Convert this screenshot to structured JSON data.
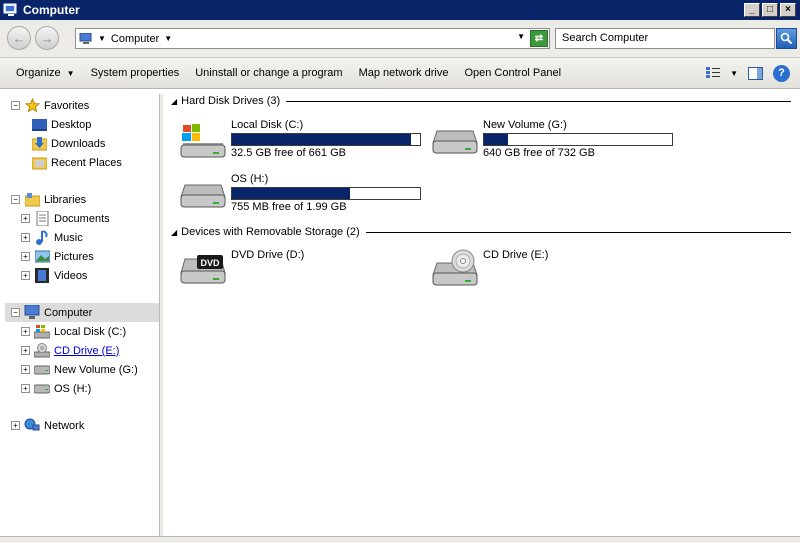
{
  "window": {
    "title": "Computer"
  },
  "address": {
    "crumb": "Computer"
  },
  "search": {
    "placeholder": "Search Computer"
  },
  "toolbar": {
    "organize": "Organize",
    "system_properties": "System properties",
    "uninstall": "Uninstall or change a program",
    "map_drive": "Map network drive",
    "control_panel": "Open Control Panel"
  },
  "nav": {
    "favorites": "Favorites",
    "desktop": "Desktop",
    "downloads": "Downloads",
    "recent": "Recent Places",
    "libraries": "Libraries",
    "documents": "Documents",
    "music": "Music",
    "pictures": "Pictures",
    "videos": "Videos",
    "computer": "Computer",
    "local_c": "Local Disk (C:)",
    "cd_e": "CD Drive (E:)",
    "new_g": "New Volume (G:)",
    "os_h": "OS (H:)",
    "network": "Network"
  },
  "groups": {
    "hdd": "Hard Disk Drives (3)",
    "removable": "Devices with Removable Storage (2)"
  },
  "drives": {
    "c": {
      "name": "Local Disk (C:)",
      "free": "32.5 GB free of 661 GB",
      "used_fraction": 0.95
    },
    "g": {
      "name": "New Volume (G:)",
      "free": "640 GB free of 732 GB",
      "used_fraction": 0.13
    },
    "h": {
      "name": "OS (H:)",
      "free": "755 MB free of 1.99 GB",
      "used_fraction": 0.63
    },
    "d": {
      "name": "DVD Drive (D:)",
      "badge": "DVD"
    },
    "e": {
      "name": "CD Drive (E:)"
    }
  },
  "colors": {
    "titlebar": "#0a246a",
    "bar_fill": "#0a246a",
    "link": "#0000cc"
  }
}
